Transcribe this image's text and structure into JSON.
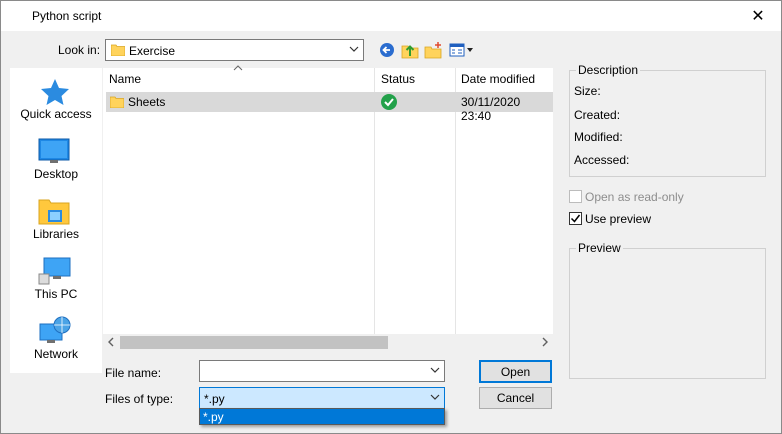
{
  "window": {
    "title": "Python script",
    "close_glyph": "✕"
  },
  "look_in": {
    "label": "Look in:",
    "value": "Exercise"
  },
  "places": [
    {
      "label": "Quick access",
      "icon": "star-icon"
    },
    {
      "label": "Desktop",
      "icon": "desktop-icon"
    },
    {
      "label": "Libraries",
      "icon": "libraries-icon"
    },
    {
      "label": "This PC",
      "icon": "computer-icon"
    },
    {
      "label": "Network",
      "icon": "network-icon"
    }
  ],
  "file_list": {
    "columns": [
      "Name",
      "Status",
      "Date modified"
    ],
    "rows": [
      {
        "name": "Sheets",
        "status_icon": "check-circle-icon",
        "date_modified": "30/11/2020 23:40"
      }
    ]
  },
  "file_name": {
    "label": "File name:",
    "value": ""
  },
  "files_of_type": {
    "label": "Files of type:",
    "value": "*.py",
    "options": [
      "*.py"
    ]
  },
  "buttons": {
    "open": "Open",
    "cancel": "Cancel"
  },
  "description": {
    "title": "Description",
    "fields": [
      "Size:",
      "Created:",
      "Modified:",
      "Accessed:"
    ]
  },
  "options": {
    "read_only_label": "Open as read-only",
    "read_only_checked": false,
    "use_preview_label": "Use preview",
    "use_preview_checked": true
  },
  "preview": {
    "title": "Preview"
  },
  "colors": {
    "accent": "#0078d7",
    "selection": "#cce8ff",
    "row_selected": "#d9d9d9"
  }
}
